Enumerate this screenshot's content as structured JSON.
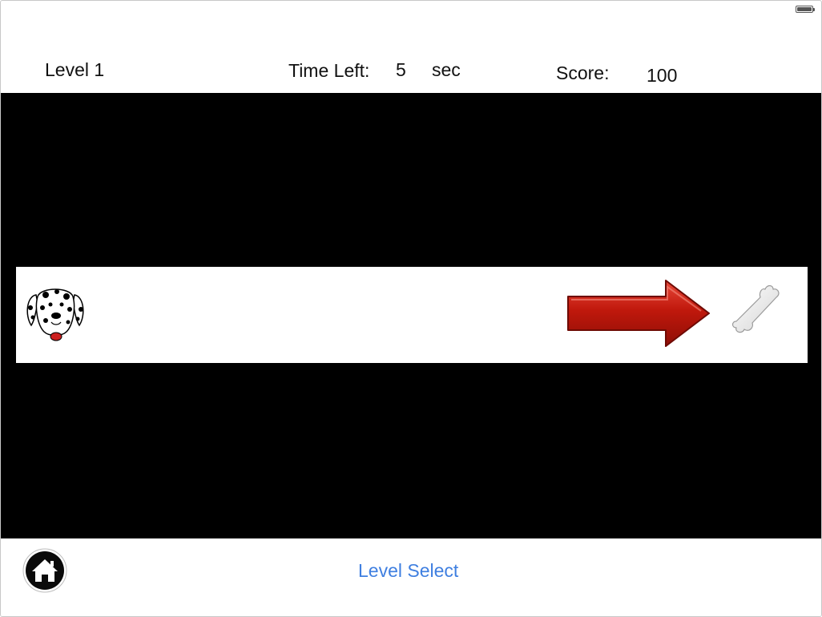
{
  "hud": {
    "level_label": "Level 1",
    "time_left_label": "Time Left:",
    "time_left_value": "5",
    "time_unit": "sec",
    "score_label": "Score:",
    "score_value": "100"
  },
  "game": {
    "player_icon": "dalmatian-dog-icon",
    "direction_icon": "right-arrow-icon",
    "target_icon": "bone-icon",
    "colors": {
      "play_area": "#000000",
      "lane": "#ffffff",
      "arrow": "#c0180c"
    }
  },
  "footer": {
    "home_icon": "home-icon",
    "level_select_label": "Level Select",
    "link_color": "#3f7fe0"
  }
}
